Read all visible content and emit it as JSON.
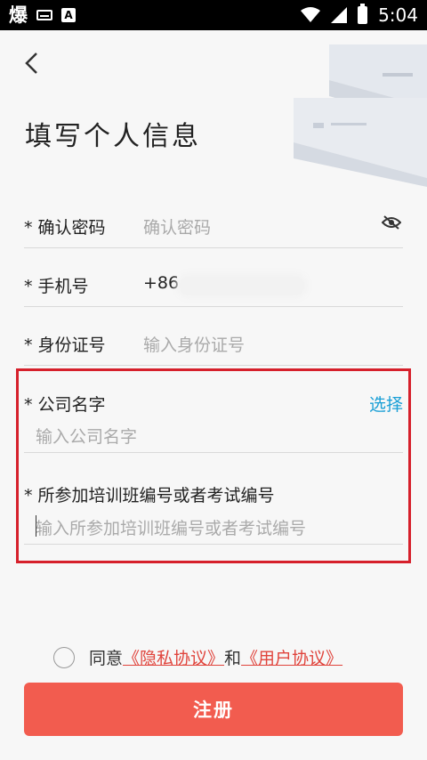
{
  "status_bar": {
    "app_glyph": "爆",
    "keyboard_icon": "keyboard-icon",
    "a_glyph": "A",
    "time": "5:04"
  },
  "page": {
    "title": "填写个人信息"
  },
  "form": {
    "confirm_password": {
      "label": "* 确认密码",
      "placeholder": "确认密码"
    },
    "phone": {
      "label": "* 手机号",
      "value": "+86"
    },
    "id_card": {
      "label": "* 身份证号",
      "placeholder": "输入身份证号"
    },
    "company": {
      "label": "* 公司名字",
      "placeholder": "输入公司名字",
      "select_label": "选择"
    },
    "training": {
      "label": "* 所参加培训班编号或者考试编号",
      "placeholder": "输入所参加培训班编号或者考试编号"
    }
  },
  "agreement": {
    "prefix": "同意",
    "privacy_link": "《隐私协议》",
    "and": "和",
    "user_link": "《用户协议》"
  },
  "submit_label": "注册",
  "colors": {
    "accent_button": "#f25c4f",
    "link": "#e0443c",
    "select": "#1a9fd6",
    "highlight_border": "#d6202b"
  }
}
